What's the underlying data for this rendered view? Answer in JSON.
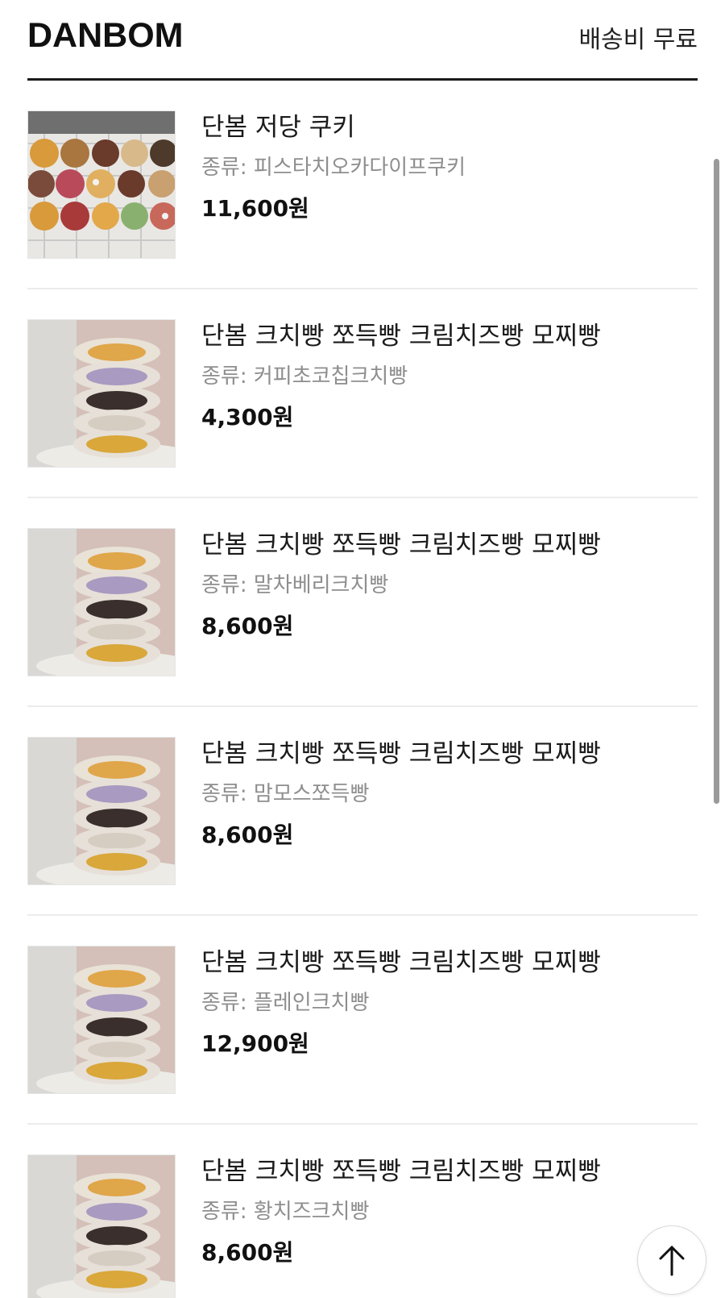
{
  "header": {
    "brand": "DANBOM",
    "shipping": "배송비 무료"
  },
  "products": [
    {
      "title": "단봄 저당 쿠키",
      "variant": "종류: 피스타치오카다이프쿠키",
      "price": "11,600원",
      "image": "cookie-photo"
    },
    {
      "title": "단봄 크치빵 쪼득빵 크림치즈빵 모찌빵",
      "variant": "종류: 커피초코칩크치빵",
      "price": "4,300원",
      "image": "bread-stack-photo"
    },
    {
      "title": "단봄 크치빵 쪼득빵 크림치즈빵 모찌빵",
      "variant": "종류: 말차베리크치빵",
      "price": "8,600원",
      "image": "bread-stack-photo"
    },
    {
      "title": "단봄 크치빵 쪼득빵 크림치즈빵 모찌빵",
      "variant": "종류: 맘모스쪼득빵",
      "price": "8,600원",
      "image": "bread-stack-photo"
    },
    {
      "title": "단봄 크치빵 쪼득빵 크림치즈빵 모찌빵",
      "variant": "종류: 플레인크치빵",
      "price": "12,900원",
      "image": "bread-stack-photo"
    },
    {
      "title": "단봄 크치빵 쪼득빵 크림치즈빵 모찌빵",
      "variant": "종류: 황치즈크치빵",
      "price": "8,600원",
      "image": "bread-stack-photo"
    }
  ],
  "scroll_top": {
    "icon": "arrow-up-icon"
  },
  "colors": {
    "text": "#111111",
    "muted": "#8e8e8e",
    "divider": "#ececec"
  }
}
